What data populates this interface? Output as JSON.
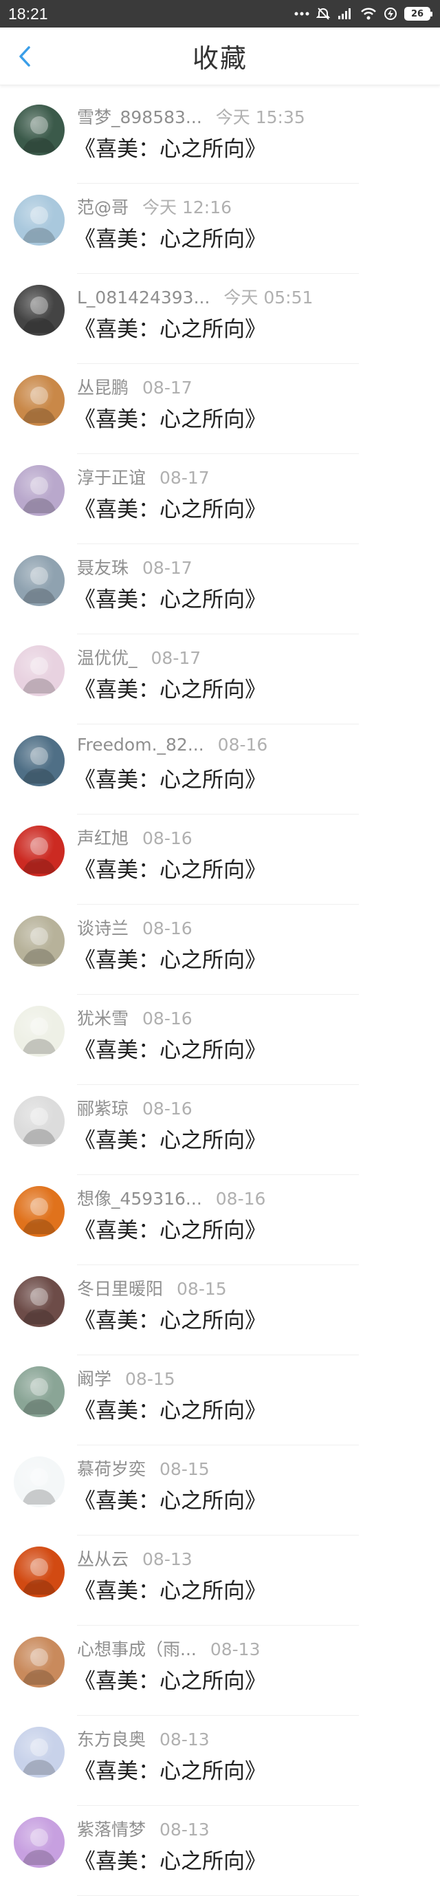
{
  "status_bar": {
    "time": "18:21",
    "icons": [
      "more-dots-icon",
      "alarm-off-icon",
      "signal-hd-icon",
      "wifi-icon",
      "charging-icon"
    ],
    "battery": "26"
  },
  "header": {
    "title": "收藏",
    "back_icon": "chevron-left-icon",
    "accent": "#3a9ee8"
  },
  "favorites": [
    {
      "name": "雪梦_898583...",
      "time": "今天 15:35",
      "title": "《喜美：心之所向》",
      "avatar_color": "#3b5a4a"
    },
    {
      "name": "范@哥",
      "time": "今天 12:16",
      "title": "《喜美：心之所向》",
      "avatar_color": "#a9c8dd"
    },
    {
      "name": "L_081424393...",
      "time": "今天 05:51",
      "title": "《喜美：心之所向》",
      "avatar_color": "#444444"
    },
    {
      "name": "丛昆鹏",
      "time": "08-17",
      "title": "《喜美：心之所向》",
      "avatar_color": "#c98848"
    },
    {
      "name": "淳于正谊",
      "time": "08-17",
      "title": "《喜美：心之所向》",
      "avatar_color": "#b9a8cc"
    },
    {
      "name": "聂友珠",
      "time": "08-17",
      "title": "《喜美：心之所向》",
      "avatar_color": "#8fa2b0"
    },
    {
      "name": "温优优_",
      "time": "08-17",
      "title": "《喜美：心之所向》",
      "avatar_color": "#e8d2e0"
    },
    {
      "name": "Freedom._82...",
      "time": "08-16",
      "title": "《喜美：心之所向》",
      "avatar_color": "#4f6f86"
    },
    {
      "name": "声红旭",
      "time": "08-16",
      "title": "《喜美：心之所向》",
      "avatar_color": "#cc2a22"
    },
    {
      "name": "谈诗兰",
      "time": "08-16",
      "title": "《喜美：心之所向》",
      "avatar_color": "#b7b29a"
    },
    {
      "name": "犹米雪",
      "time": "08-16",
      "title": "《喜美：心之所向》",
      "avatar_color": "#eef0e6"
    },
    {
      "name": "郦紫琼",
      "time": "08-16",
      "title": "《喜美：心之所向》",
      "avatar_color": "#dcdcdc"
    },
    {
      "name": "想像_459316...",
      "time": "08-16",
      "title": "《喜美：心之所向》",
      "avatar_color": "#e0721c"
    },
    {
      "name": "冬日里暖阳",
      "time": "08-15",
      "title": "《喜美：心之所向》",
      "avatar_color": "#6d4c48"
    },
    {
      "name": "阚学",
      "time": "08-15",
      "title": "《喜美：心之所向》",
      "avatar_color": "#8aa596"
    },
    {
      "name": "慕荷岁奕",
      "time": "08-15",
      "title": "《喜美：心之所向》",
      "avatar_color": "#f4f7f8"
    },
    {
      "name": "丛从云",
      "time": "08-13",
      "title": "《喜美：心之所向》",
      "avatar_color": "#d24a12"
    },
    {
      "name": "心想事成（雨...",
      "time": "08-13",
      "title": "《喜美：心之所向》",
      "avatar_color": "#c98a5c"
    },
    {
      "name": "东方良奥",
      "time": "08-13",
      "title": "《喜美：心之所向》",
      "avatar_color": "#c8d2ea"
    },
    {
      "name": "紫落情梦",
      "time": "08-13",
      "title": "《喜美：心之所向》",
      "avatar_color": "#c7a0e0"
    }
  ]
}
